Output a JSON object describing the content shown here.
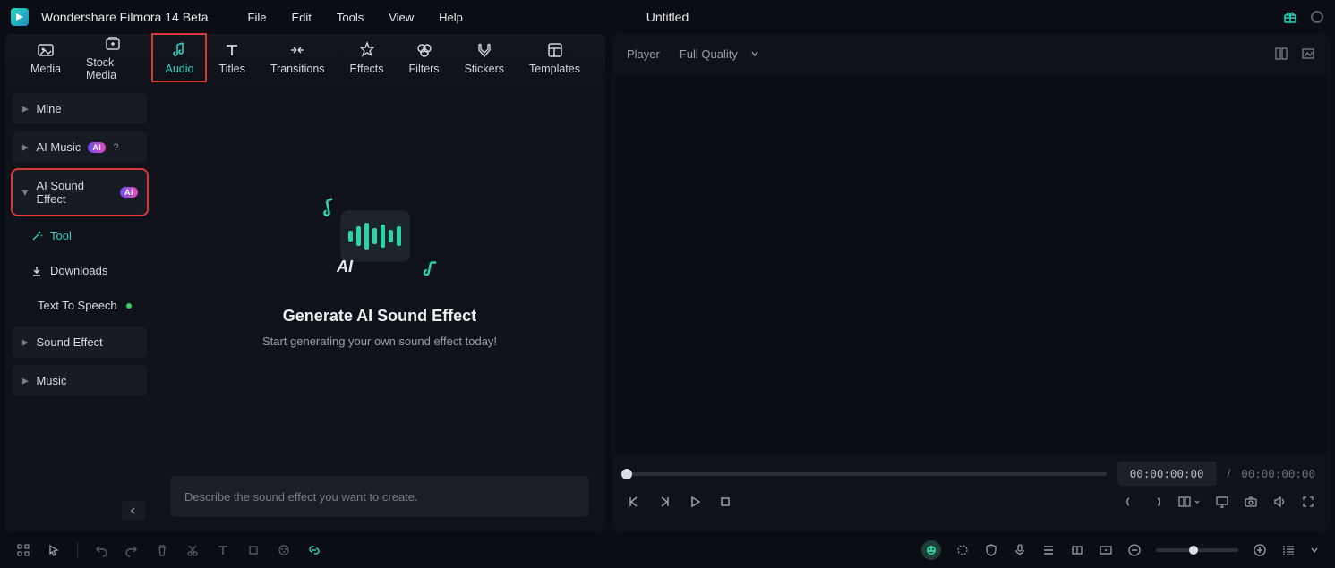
{
  "app": {
    "title": "Wondershare Filmora 14 Beta",
    "doc": "Untitled"
  },
  "menu": {
    "file": "File",
    "edit": "Edit",
    "tools": "Tools",
    "view": "View",
    "help": "Help"
  },
  "tabs": {
    "media": "Media",
    "stock": "Stock Media",
    "audio": "Audio",
    "titles": "Titles",
    "transitions": "Transitions",
    "effects": "Effects",
    "filters": "Filters",
    "stickers": "Stickers",
    "templates": "Templates"
  },
  "sidebar": {
    "mine": "Mine",
    "ai_music": "AI Music",
    "ai_sfx": "AI Sound Effect",
    "tool": "Tool",
    "downloads": "Downloads",
    "tts": "Text To Speech",
    "sfx": "Sound Effect",
    "music": "Music",
    "ai_badge": "AI"
  },
  "hero": {
    "title": "Generate AI Sound Effect",
    "sub": "Start generating your own sound effect today!",
    "ai": "AI"
  },
  "prompt": {
    "placeholder": "Describe the sound effect you want to create."
  },
  "player": {
    "label": "Player",
    "quality": "Full Quality",
    "time": "00:00:00:00",
    "total": "00:00:00:00",
    "sep": "/"
  },
  "colors": {
    "accent": "#2ad4c0",
    "highlight": "#d43a3a"
  }
}
